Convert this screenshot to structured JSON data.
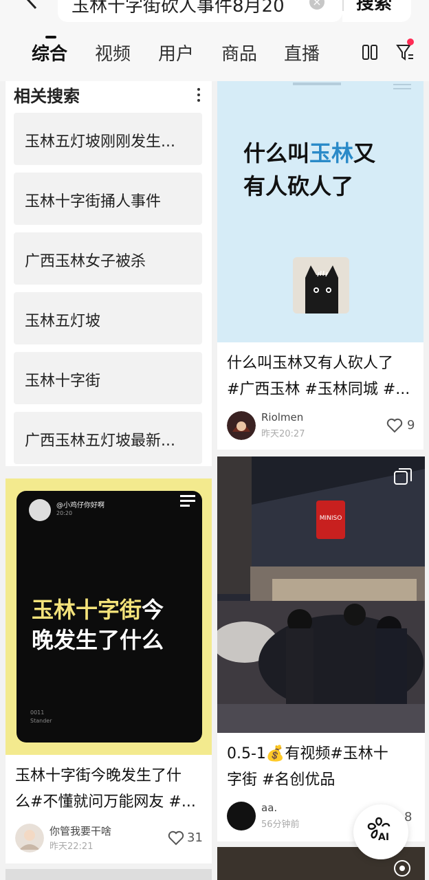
{
  "header": {
    "search_query": "玉林十字街砍人事件8月20",
    "search_button": "搜索"
  },
  "tabs": [
    {
      "label": "综合",
      "active": true
    },
    {
      "label": "视频",
      "active": false
    },
    {
      "label": "用户",
      "active": false
    },
    {
      "label": "商品",
      "active": false
    },
    {
      "label": "直播",
      "active": false
    }
  ],
  "related": {
    "title": "相关搜索",
    "items": [
      "玉林五灯坡刚刚发生...",
      "玉林十字街捅人事件",
      "广西玉林女子被杀",
      "玉林五灯坡",
      "玉林十字街",
      "广西玉林五灯坡最新..."
    ]
  },
  "left_card": {
    "cover_brand": "@小鸡仔你好啊",
    "cover_sub": "20:20",
    "cover_line1_highlight": "玉林十字街",
    "cover_line1_rest": "今",
    "cover_line2": "晚发生了什么",
    "cover_footer1": "0011",
    "cover_footer2": "Stander",
    "title_line1": "玉林十字街今晚发生了什",
    "title_line2": "么#不懂就问万能网友 #...",
    "author": "你管我要干啥",
    "time": "昨天22:21",
    "likes": "31"
  },
  "right_card_1": {
    "cover_line1_pre": "什么叫",
    "cover_line1_highlight": "玉林",
    "cover_line1_post": "又",
    "cover_line2": "有人砍人了",
    "title_line1": "什么叫玉林又有人砍人了",
    "title_line2": "#广西玉林 #玉林同城 #...",
    "author": "Riolmen",
    "time": "昨天20:27",
    "likes": "9"
  },
  "right_card_2": {
    "store_sign": "MINISO",
    "title_line1": "0.5-1💰有视频#玉林十",
    "title_line2": "字街 #名创优品",
    "author": "aa.",
    "time": "56分钟前",
    "likes": "8"
  },
  "ai_button": {
    "label": "AI"
  }
}
